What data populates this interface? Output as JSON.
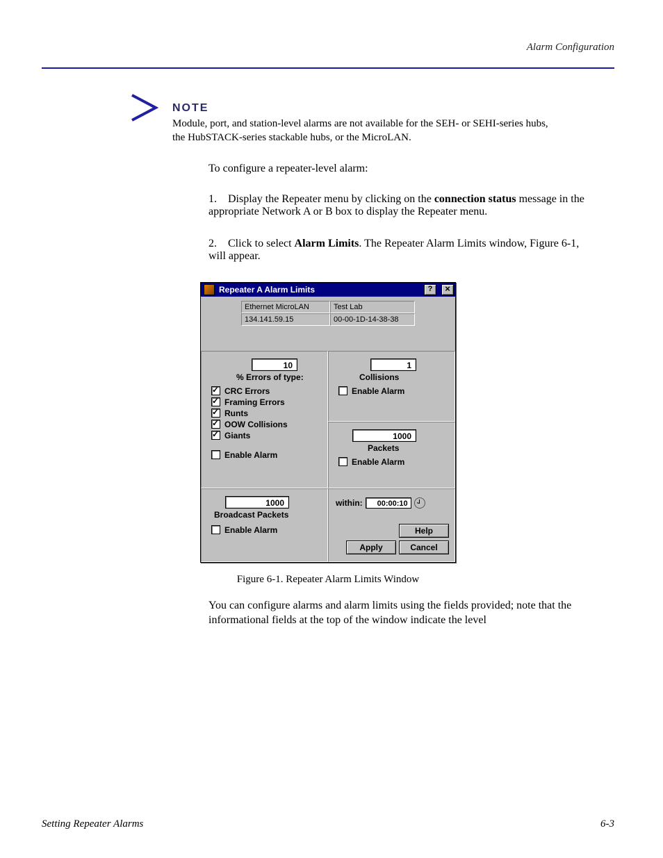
{
  "header_right": "Alarm Configuration",
  "note": {
    "label": "NOTE",
    "text": "Module, port, and station-level alarms are not available for the SEH- or SEHI-series hubs, the HubSTACK-series stackable hubs, or the MicroLAN."
  },
  "body_intro": "To configure a repeater-level alarm:",
  "step": {
    "num": "1.",
    "text_before": "Display the Repeater menu by clicking on the ",
    "bold": "connection status",
    "text_after": " message in the appropriate Network A or B box to display the Repeater menu."
  },
  "step2_single": {
    "num": "2.",
    "text_before": "Click to select ",
    "bold": "Alarm Limits",
    "text_after": ". The Repeater Alarm Limits window, Figure 6-1, will appear."
  },
  "dialog": {
    "title": "Repeater A Alarm Limits",
    "info": {
      "name": "Ethernet MicroLAN",
      "loc": "Test Lab",
      "ip": "134.141.59.15",
      "mac": "00-00-1D-14-38-38"
    },
    "collisions": {
      "value": "1",
      "label": "Collisions",
      "enable": "Enable Alarm"
    },
    "packets": {
      "value": "1000",
      "label": "Packets",
      "enable": "Enable Alarm"
    },
    "broadcast": {
      "value": "1000",
      "label": "Broadcast Packets",
      "enable": "Enable Alarm"
    },
    "errors": {
      "value": "10",
      "label": "% Errors of type:",
      "types": [
        "CRC Errors",
        "Framing Errors",
        "Runts",
        "OOW Collisions",
        "Giants"
      ],
      "enable": "Enable Alarm"
    },
    "within_label": "within:",
    "within_value": "00:00:10",
    "buttons": {
      "help": "Help",
      "apply": "Apply",
      "cancel": "Cancel"
    }
  },
  "fig_caption": "Figure 6-1. Repeater Alarm Limits Window",
  "post_lead": "You can configure alarms and alarm limits using the fields provided; note that the informational fields at the top of the window indicate the level ",
  "footer_left": "Setting Repeater Alarms",
  "footer_right": "6-3"
}
